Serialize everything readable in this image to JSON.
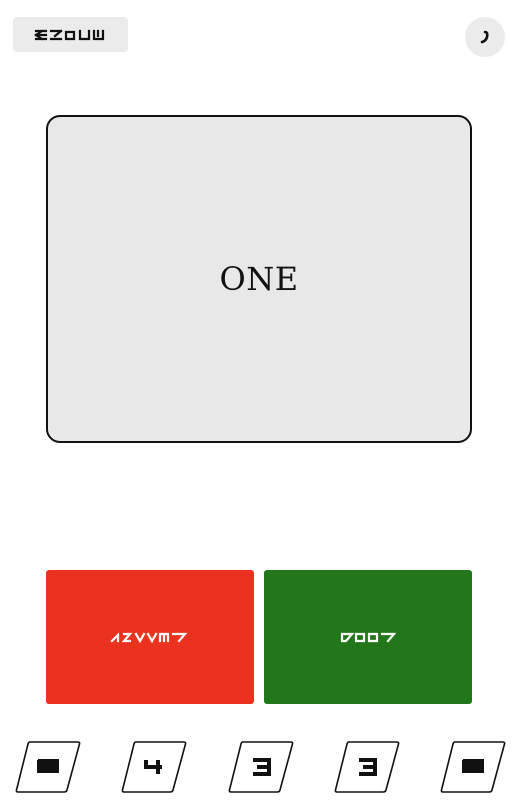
{
  "card": {
    "word": "ONE"
  },
  "top_button": {
    "icon": "aurebesh-glyphs"
  },
  "menu_button": {
    "icon": "comma-glyph"
  },
  "answers": [
    {
      "name": "wrong-button",
      "icon": "aurebesh-glyphs",
      "color": "#ea321e"
    },
    {
      "name": "right-button",
      "icon": "aurebesh-glyphs",
      "color": "#22771a"
    }
  ],
  "ratings": [
    {
      "value": 5
    },
    {
      "value": 4
    },
    {
      "value": 3
    },
    {
      "value": 3
    },
    {
      "value": 5
    }
  ]
}
